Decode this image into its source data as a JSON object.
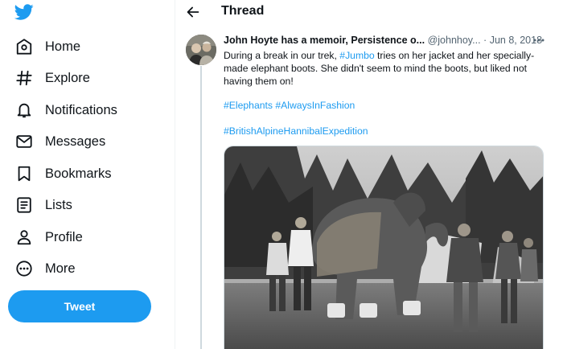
{
  "app": {
    "brand_color": "#1d9bf0",
    "logo": "twitter-bird-icon"
  },
  "sidebar": {
    "items": [
      {
        "label": "Home",
        "icon": "home-icon"
      },
      {
        "label": "Explore",
        "icon": "hashtag-icon"
      },
      {
        "label": "Notifications",
        "icon": "bell-icon"
      },
      {
        "label": "Messages",
        "icon": "envelope-icon"
      },
      {
        "label": "Bookmarks",
        "icon": "bookmark-icon"
      },
      {
        "label": "Lists",
        "icon": "list-icon"
      },
      {
        "label": "Profile",
        "icon": "person-icon"
      },
      {
        "label": "More",
        "icon": "more-circle-icon"
      }
    ],
    "tweet_button": "Tweet"
  },
  "header": {
    "title": "Thread"
  },
  "tweet": {
    "author": "John Hoyte has a memoir, Persistence o...",
    "handle": "@johnhoy...",
    "separator": "·",
    "date": "Jun 8, 2018",
    "text_before": "During a break in our trek, ",
    "mention_tag": "#Jumbo",
    "text_after": " tries on her jacket and her specially-made elephant boots. She didn't seem to mind the boots, but liked not having them on!",
    "tag_elephants": "#Elephants",
    "tag_fashion": "#AlwaysInFashion",
    "tag_expedition": "#BritishAlpineHannibalExpedition"
  }
}
